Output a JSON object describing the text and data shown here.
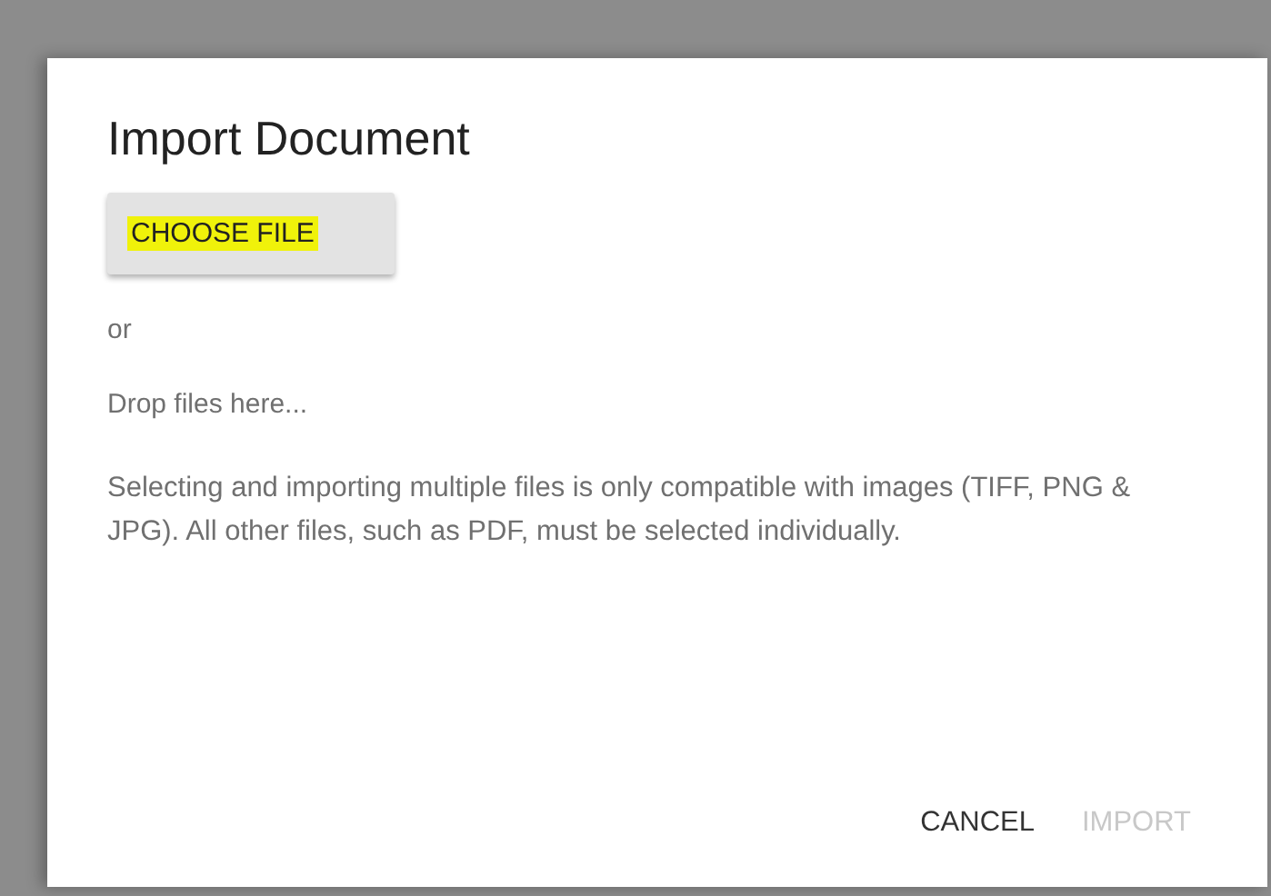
{
  "dialog": {
    "title": "Import Document",
    "choose_button": {
      "label": "CHOOSE FILE",
      "highlighted": true
    },
    "or_text": "or",
    "drop_hint": "Drop files here...",
    "note": "Selecting and importing multiple files is only compatible with images (TIFF, PNG & JPG). All other files, such as PDF, must be selected individually.",
    "actions": [
      {
        "label": "CANCEL",
        "disabled": false
      },
      {
        "label": "IMPORT",
        "disabled": true
      }
    ]
  }
}
